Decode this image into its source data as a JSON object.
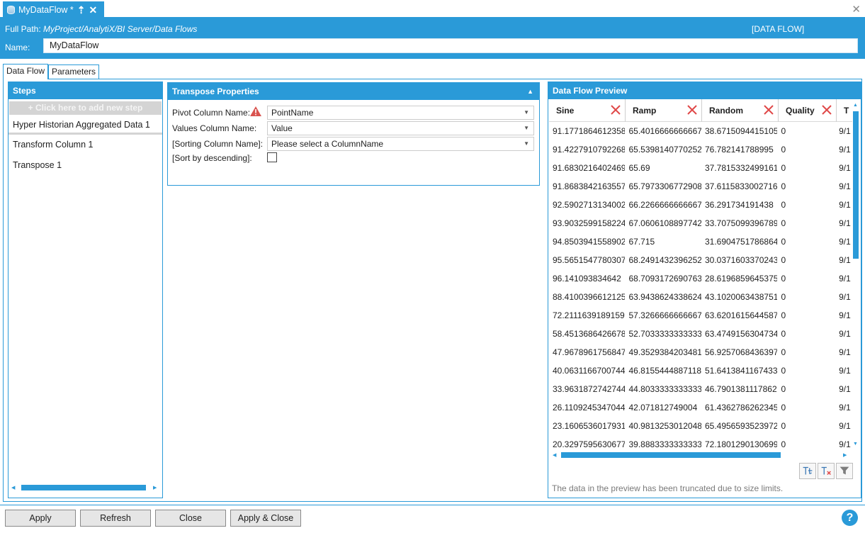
{
  "document_tab": {
    "title": "MyDataFlow *",
    "db_icon": "database-icon",
    "pin_icon": "pin-icon",
    "close_icon": "close-icon"
  },
  "window": {
    "close_icon": "close-icon"
  },
  "header": {
    "full_path_label": "Full Path:",
    "full_path_value": "MyProject/AnalytiX/BI Server/Data Flows",
    "type_label": "[DATA FLOW]",
    "name_label": "Name:",
    "name_value": "MyDataFlow"
  },
  "view_tabs": [
    {
      "label": "Data Flow",
      "active": true
    },
    {
      "label": "Parameters",
      "active": false
    }
  ],
  "steps_panel": {
    "title": "Steps",
    "add_step_label": "+ Click here to add new step",
    "steps": [
      {
        "label": "Hyper Historian Aggregated Data  1"
      },
      {
        "label": "Transform Column  1"
      },
      {
        "label": "Transpose  1"
      }
    ]
  },
  "transpose_panel": {
    "title": "Transpose Properties",
    "collapse_icon": "chevron-up-icon",
    "fields": {
      "pivot_label": "Pivot Column Name:",
      "pivot_value": "PointName",
      "values_label": "Values Column Name:",
      "values_value": "Value",
      "sorting_label": "[Sorting Column Name]:",
      "sorting_value": "Please select a ColumnName",
      "descending_label": "[Sort by descending]:",
      "descending_checked": false
    },
    "warning_icon": "warning-icon"
  },
  "preview_panel": {
    "title": "Data Flow Preview",
    "columns": [
      "Sine",
      "Ramp",
      "Random",
      "Quality",
      "T"
    ],
    "rows": [
      [
        "91.1771864612358",
        "65.4016666666667",
        "38.6715094415105",
        "0",
        "9/1"
      ],
      [
        "91.4227910792268",
        "65.5398140770252",
        "76.782141788995",
        "0",
        "9/1"
      ],
      [
        "91.6830216402469",
        "65.69",
        "37.7815332499161",
        "0",
        "9/1"
      ],
      [
        "91.8683842163557",
        "65.7973306772908",
        "37.6115833002716",
        "0",
        "9/1"
      ],
      [
        "92.5902713134002",
        "66.2266666666667",
        "36.291734191438",
        "0",
        "9/1"
      ],
      [
        "93.9032599158224",
        "67.0606108897742",
        "33.7075099396789",
        "0",
        "9/1"
      ],
      [
        "94.8503941558902",
        "67.715",
        "31.6904751786864",
        "0",
        "9/1"
      ],
      [
        "95.5651547780307",
        "68.2491432396252",
        "30.0371603370243",
        "0",
        "9/1"
      ],
      [
        "96.141093834642",
        "68.7093172690763",
        "28.6196859645375",
        "0",
        "9/1"
      ],
      [
        "88.4100396612125",
        "63.9438624338624",
        "43.1020063438751",
        "0",
        "9/1"
      ],
      [
        "72.2111639189159",
        "57.3266666666667",
        "63.6201615644587",
        "0",
        "9/1"
      ],
      [
        "58.4513686426678",
        "52.7033333333333",
        "63.4749156304734",
        "0",
        "9/1"
      ],
      [
        "47.9678961756847",
        "49.3529384203481",
        "56.9257068436397",
        "0",
        "9/1"
      ],
      [
        "40.0631166700744",
        "46.8155444887118",
        "51.6413841167433",
        "0",
        "9/1"
      ],
      [
        "33.9631872742744",
        "44.8033333333333",
        "46.7901381117862",
        "0",
        "9/1"
      ],
      [
        "26.1109245347044",
        "42.071812749004",
        "61.4362786262345",
        "0",
        "9/1"
      ],
      [
        "23.1606536017931",
        "40.9813253012048",
        "65.4956593523972",
        "0",
        "9/1"
      ],
      [
        "20.3297595630677",
        "39.8883333333333",
        "72.1801290130699",
        "0",
        "9/1"
      ]
    ],
    "remove_column_icon": "remove-column-icon",
    "toolbar_icons": [
      "add-column-icon",
      "remove-column-icon",
      "filter-icon"
    ],
    "truncated_note": "The data in the preview has been truncated due to size limits."
  },
  "buttons": {
    "apply": "Apply",
    "refresh": "Refresh",
    "close": "Close",
    "apply_close": "Apply & Close"
  },
  "help": {
    "label": "?",
    "icon": "help-icon"
  },
  "colors": {
    "accent": "#2a9ad8",
    "warning": "#d9534f",
    "remove": "#e04848"
  }
}
